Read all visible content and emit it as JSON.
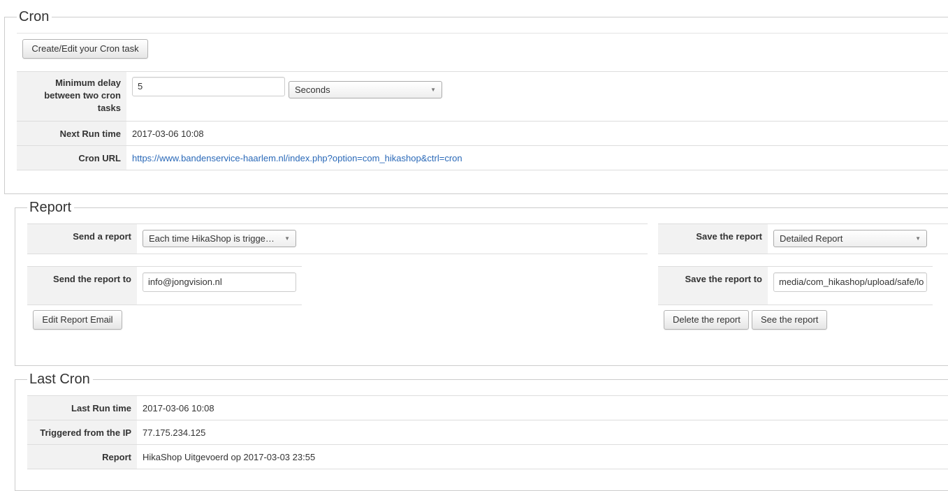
{
  "cron": {
    "legend": "Cron",
    "create_button": "Create/Edit your Cron task",
    "min_delay_label": "Minimum delay between two cron tasks",
    "min_delay_value": "5",
    "delay_unit": "Seconds",
    "next_run_label": "Next Run time",
    "next_run_value": "2017-03-06 10:08",
    "cron_url_label": "Cron URL",
    "cron_url_value": "https://www.bandenservice-haarlem.nl/index.php?option=com_hikashop&ctrl=cron"
  },
  "report": {
    "legend": "Report",
    "send_label": "Send a report",
    "send_value": "Each time HikaShop is trigge…",
    "send_to_label": "Send the report to",
    "send_to_value": "info@jongvision.nl",
    "edit_email_button": "Edit Report Email",
    "save_label": "Save the report",
    "save_value": "Detailed Report",
    "save_to_label": "Save the report to",
    "save_to_value": "media/com_hikashop/upload/safe/lo",
    "delete_button": "Delete the report",
    "see_button": "See the report"
  },
  "last_cron": {
    "legend": "Last Cron",
    "last_run_label": "Last Run time",
    "last_run_value": "2017-03-06 10:08",
    "ip_label": "Triggered from the IP",
    "ip_value": "77.175.234.125",
    "report_label": "Report",
    "report_value": "HikaShop Uitgevoerd op 2017-03-03 23:55"
  },
  "colors": {
    "link": "#2a69b8",
    "label_bg": "#f2f2f2",
    "border": "#cccccc"
  },
  "icons": {
    "select_caret": "caret-down-icon"
  }
}
